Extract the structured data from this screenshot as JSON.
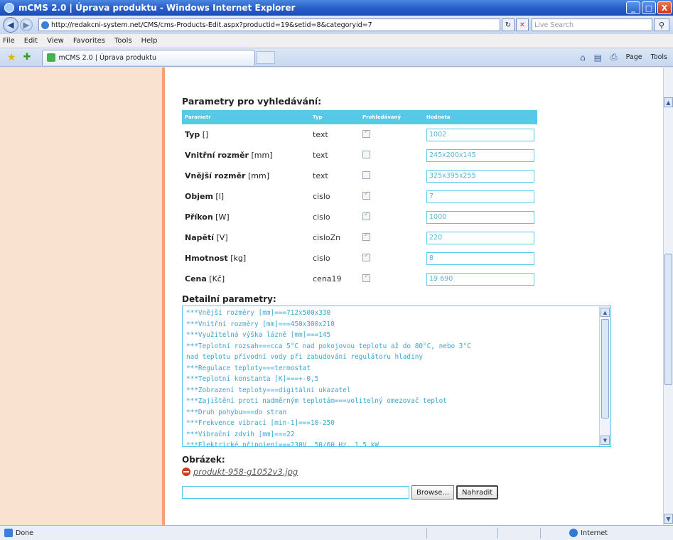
{
  "window": {
    "title": "mCMS 2.0 | Úprava produktu - Windows Internet Explorer",
    "minimize": "_",
    "maximize": "□",
    "close": "X"
  },
  "address": {
    "url": "http://redakcni-system.net/CMS/cms-Products-Edit.aspx?productid=19&setid=8&categoryid=7",
    "search_placeholder": "Live Search",
    "back_icon": "arrow-left-icon",
    "forward_icon": "arrow-right-icon"
  },
  "menu": [
    "File",
    "Edit",
    "View",
    "Favorites",
    "Tools",
    "Help"
  ],
  "tab": {
    "label": "mCMS 2.0 | Úprava produktu"
  },
  "commandbar": {
    "page": "Page",
    "tools": "Tools"
  },
  "params": {
    "title": "Parametry pro vyhledávání:",
    "headers": [
      "Parametr",
      "Typ",
      "Prohledávaný",
      "Hodnota"
    ],
    "rows": [
      {
        "name": "Typ",
        "unit": "[]",
        "type": "text",
        "searchable": true,
        "value": "1002"
      },
      {
        "name": "Vnitřní rozměr",
        "unit": "[mm]",
        "type": "text",
        "searchable": false,
        "value": "245x200x145"
      },
      {
        "name": "Vnější rozměr",
        "unit": "[mm]",
        "type": "text",
        "searchable": false,
        "value": "325x395x255"
      },
      {
        "name": "Objem",
        "unit": "[l]",
        "type": "cislo",
        "searchable": true,
        "value": "7"
      },
      {
        "name": "Příkon",
        "unit": "[W]",
        "type": "cislo",
        "searchable": true,
        "value": "1000"
      },
      {
        "name": "Napětí",
        "unit": "[V]",
        "type": "cisloZn",
        "searchable": true,
        "value": "220"
      },
      {
        "name": "Hmotnost",
        "unit": "[kg]",
        "type": "cislo",
        "searchable": true,
        "value": "8"
      },
      {
        "name": "Cena",
        "unit": "[Kč]",
        "type": "cena19",
        "searchable": true,
        "value": "19 690"
      }
    ]
  },
  "detail": {
    "title": "Detailní parametry:",
    "lines": [
      "***Vnější rozměry [mm]===712x500x330",
      "***Vnitřní rozměry [mm]===450x300x210",
      "***Využitelná výška lázně [mm]===145",
      "***Teplotní rozsah===cca 5°C nad pokojovou teplotu až do 80°C, nebo 3°C",
      "nad teplotu přívodní vody při zabudování regulátoru hladiny",
      "***Regulace teploty===termostat",
      "***Teplotní konstanta [K]===+-0,5",
      "***Zobrazení teploty===digitální ukazatel",
      "***Zajištění proti nadměrným teplotám===volitelný omezovač teplot",
      "***Druh pohybu===do stran",
      "***Frekvence vibrací [min-1]===10-250",
      "***Vibrační zdvih [mm]===22",
      "***Elektrické připojení===230V, 50/60 Hz, 1,5 kW"
    ]
  },
  "image": {
    "title": "Obrázek:",
    "filename": "produkt-958-g1052v3.jpg",
    "browse": "Browse...",
    "replace": "Nahradit"
  },
  "status": {
    "left": "Done",
    "zone": "Internet"
  }
}
